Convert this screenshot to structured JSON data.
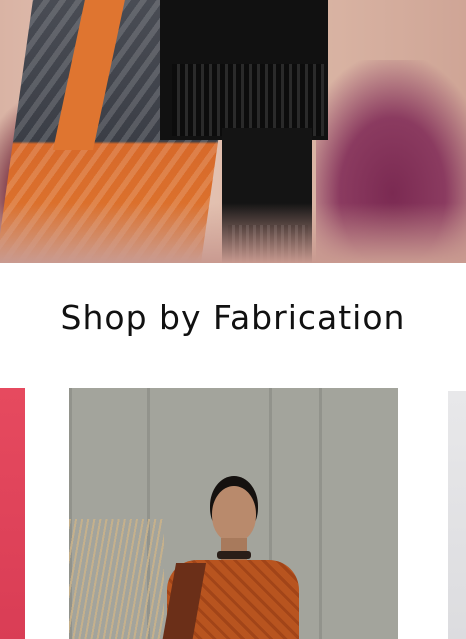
{
  "section": {
    "title": "Shop by Fabrication"
  },
  "colors": {
    "prev_card": "#e64a5f",
    "main_card_bg": "#a3a49c",
    "shirt": "#b8541f"
  }
}
